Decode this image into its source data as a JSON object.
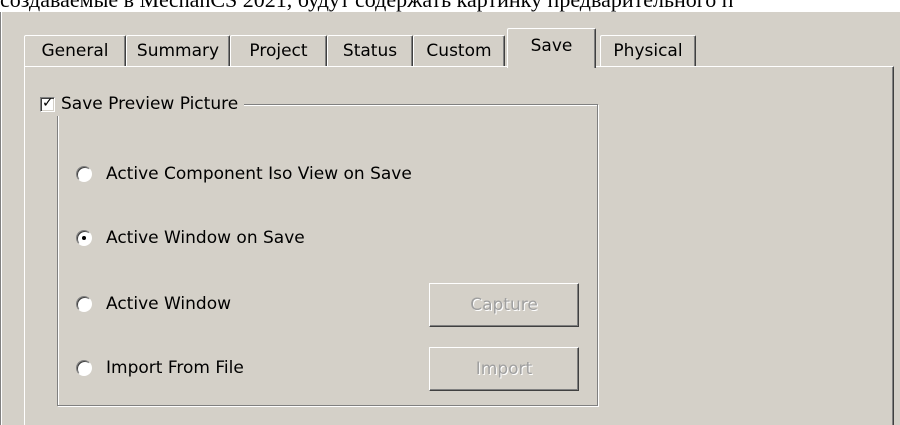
{
  "caption": "создаваемые в MechanCS 2021, будут содержать картинку предварительного п",
  "tabs": [
    {
      "label": "General",
      "active": false
    },
    {
      "label": "Summary",
      "active": false
    },
    {
      "label": "Project",
      "active": false
    },
    {
      "label": "Status",
      "active": false
    },
    {
      "label": "Custom",
      "active": false
    },
    {
      "label": "Save",
      "active": true
    },
    {
      "label": "Physical",
      "active": false
    }
  ],
  "preview_group": {
    "label": "Save Preview Picture",
    "checked": true,
    "options": [
      {
        "label": "Active Component Iso View on Save",
        "selected": false
      },
      {
        "label": "Active Window on Save",
        "selected": true
      },
      {
        "label": "Active Window",
        "selected": false
      },
      {
        "label": "Import From File",
        "selected": false
      }
    ],
    "capture_button": "Capture",
    "import_button": "Import",
    "buttons_enabled": false
  }
}
